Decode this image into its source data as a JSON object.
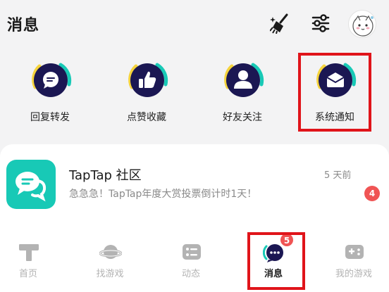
{
  "header": {
    "title": "消息",
    "icons": [
      "broom-icon",
      "sliders-icon",
      "avatar"
    ]
  },
  "shortcuts": [
    {
      "label": "回复转发",
      "icon": "chat-bubble-icon"
    },
    {
      "label": "点赞收藏",
      "icon": "thumbs-up-icon"
    },
    {
      "label": "好友关注",
      "icon": "person-icon"
    },
    {
      "label": "系统通知",
      "icon": "envelope-icon"
    }
  ],
  "message": {
    "title": "TapTap 社区",
    "time": "5 天前",
    "preview": "急急急！TapTap年度大赏投票倒计时1天！",
    "unread": "4"
  },
  "nav": {
    "items": [
      {
        "label": "首页",
        "icon": "taptap-home-icon"
      },
      {
        "label": "找游戏",
        "icon": "planet-icon"
      },
      {
        "label": "动态",
        "icon": "feed-icon"
      },
      {
        "label": "消息",
        "icon": "message-icon",
        "badge": "5"
      },
      {
        "label": "我的游戏",
        "icon": "gamepad-icon"
      }
    ]
  },
  "colors": {
    "accent_teal": "#18c9b6",
    "badge_red": "#f05454",
    "circle_navy": "#1b1753",
    "ring_yellow": "#f5d33c",
    "highlight_red": "#e0141a"
  }
}
